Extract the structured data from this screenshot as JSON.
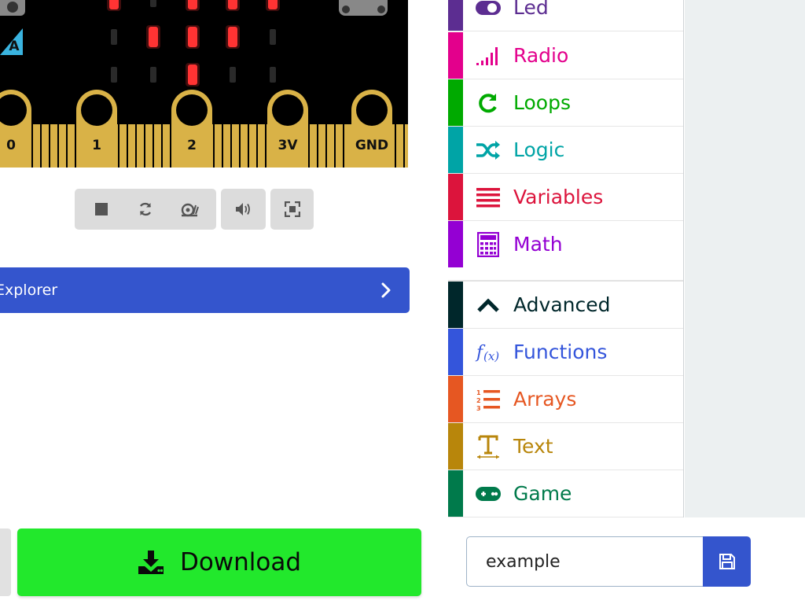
{
  "simulator": {
    "button_a_label": "A",
    "pins": [
      {
        "label": "0"
      },
      {
        "label": "1"
      },
      {
        "label": "2"
      },
      {
        "label": "3V"
      },
      {
        "label": "GND"
      }
    ],
    "colors": {
      "board": "#000000",
      "gold": "#d9b247",
      "led_on": "#ff3333",
      "led_off": "#2a2a2a",
      "btn_a": "#3ab4e0"
    }
  },
  "sim_toolbar": {
    "buttons": [
      {
        "name": "stop-button",
        "icon": "stop-icon"
      },
      {
        "name": "restart-button",
        "icon": "refresh-icon"
      },
      {
        "name": "slow-mode-button",
        "icon": "snail-icon"
      },
      {
        "name": "mute-button",
        "icon": "volume-icon"
      },
      {
        "name": "fullscreen-button",
        "icon": "fullscreen-icon"
      }
    ]
  },
  "explorer": {
    "label": "Explorer"
  },
  "toolbox": {
    "categories": [
      {
        "label": "Led",
        "color": "#5c2d91",
        "icon": "toggle-icon"
      },
      {
        "label": "Radio",
        "color": "#e3008c",
        "icon": "signal-icon"
      },
      {
        "label": "Loops",
        "color": "#00aa00",
        "icon": "loop-icon"
      },
      {
        "label": "Logic",
        "color": "#00a4a6",
        "icon": "shuffle-icon"
      },
      {
        "label": "Variables",
        "color": "#dc143c",
        "icon": "list-bars-icon"
      },
      {
        "label": "Math",
        "color": "#9400d3",
        "icon": "calculator-icon"
      }
    ],
    "advanced_categories": [
      {
        "label": "Advanced",
        "color": "#00272b",
        "icon": "chevron-up-icon"
      },
      {
        "label": "Functions",
        "color": "#3455db",
        "icon": "function-icon"
      },
      {
        "label": "Arrays",
        "color": "#e65722",
        "icon": "numbered-list-icon"
      },
      {
        "label": "Text",
        "color": "#b8860b",
        "icon": "text-icon"
      },
      {
        "label": "Game",
        "color": "#007a4b",
        "icon": "gamepad-icon"
      }
    ]
  },
  "bottom": {
    "download_label": "Download",
    "project_name": "example",
    "save_icon": "floppy-disk-icon"
  }
}
